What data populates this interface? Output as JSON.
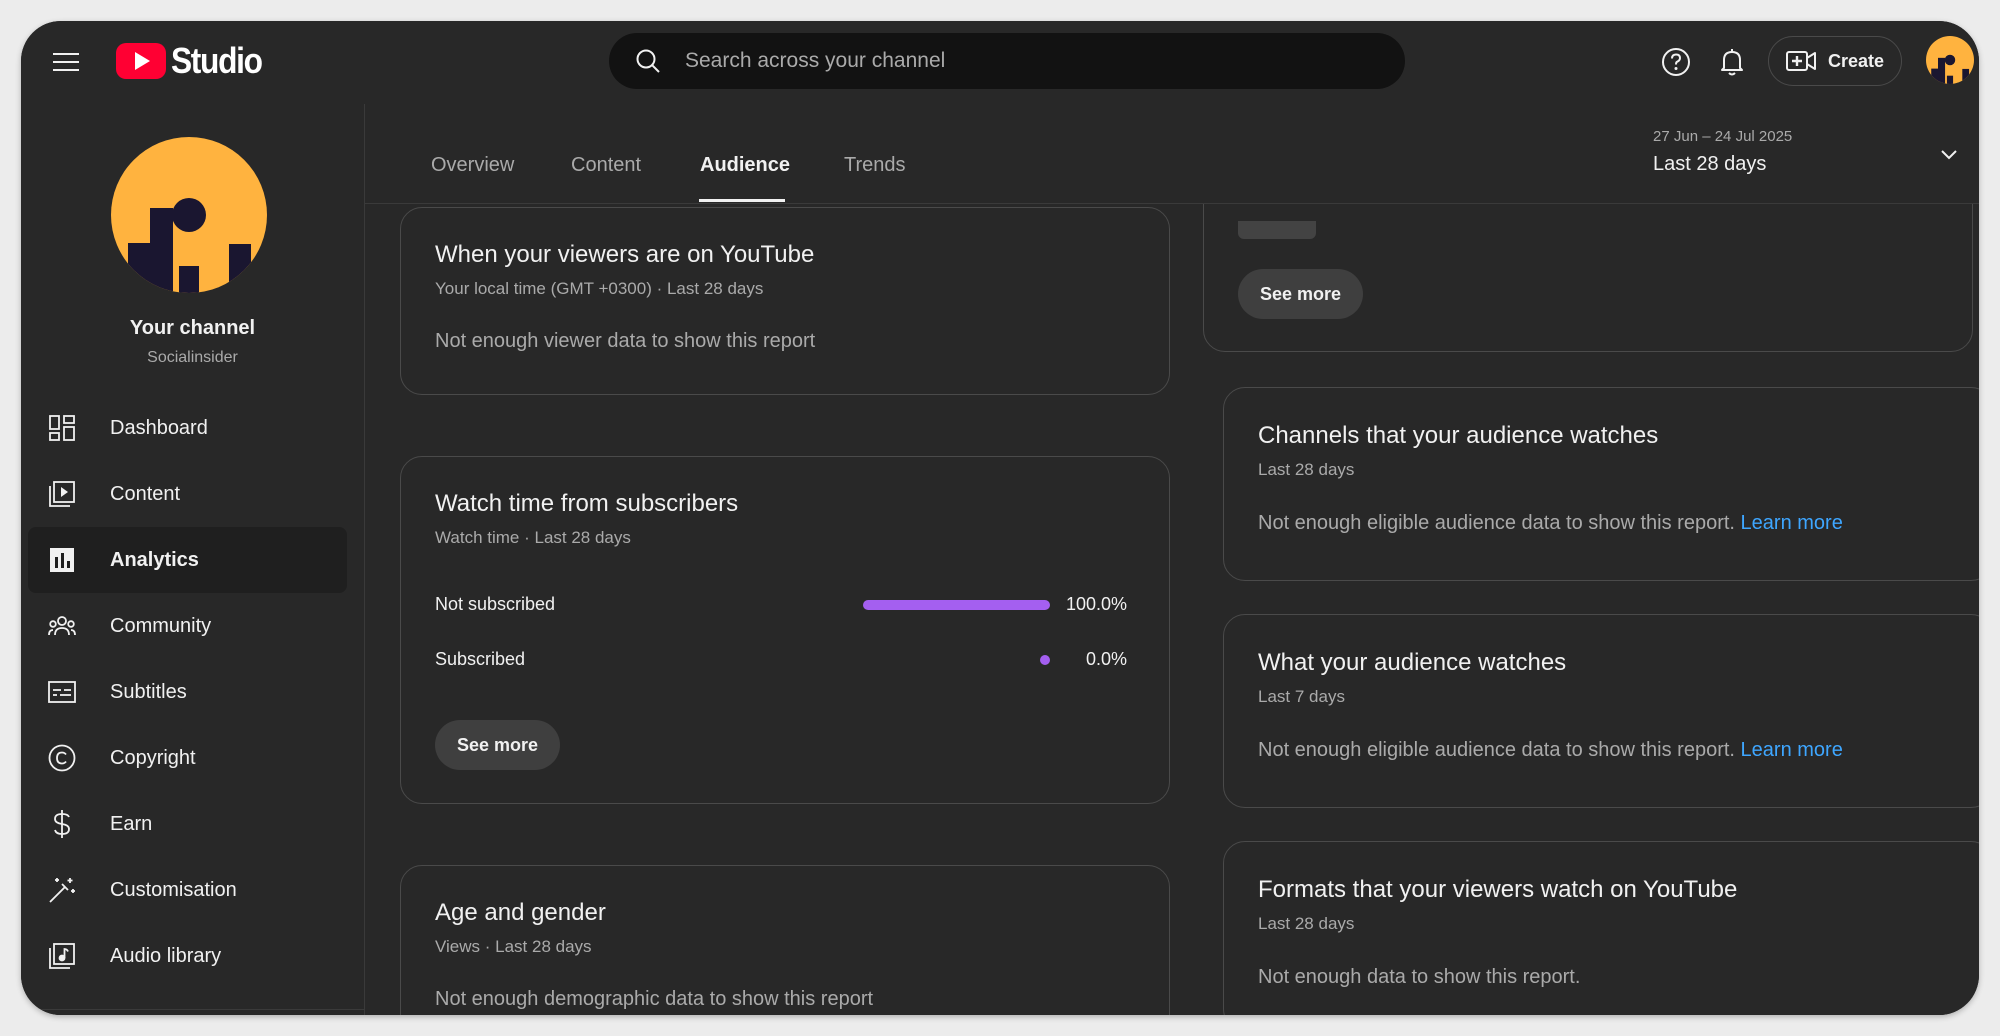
{
  "app": {
    "logo_text": "Studio"
  },
  "search": {
    "placeholder": "Search across your channel"
  },
  "header": {
    "create_label": "Create"
  },
  "channel": {
    "name": "Your channel",
    "handle": "Socialinsider"
  },
  "sidebar": {
    "items": [
      {
        "label": "Dashboard",
        "icon": "dashboard-icon"
      },
      {
        "label": "Content",
        "icon": "content-icon"
      },
      {
        "label": "Analytics",
        "icon": "analytics-icon",
        "active": true
      },
      {
        "label": "Community",
        "icon": "community-icon"
      },
      {
        "label": "Subtitles",
        "icon": "subtitles-icon"
      },
      {
        "label": "Copyright",
        "icon": "copyright-icon"
      },
      {
        "label": "Earn",
        "icon": "earn-icon"
      },
      {
        "label": "Customisation",
        "icon": "customisation-icon"
      },
      {
        "label": "Audio library",
        "icon": "audio-library-icon"
      }
    ]
  },
  "tabs": [
    {
      "label": "Overview"
    },
    {
      "label": "Content"
    },
    {
      "label": "Audience",
      "active": true
    },
    {
      "label": "Trends"
    }
  ],
  "date_range": {
    "range": "27 Jun – 24 Jul 2025",
    "label": "Last 28 days"
  },
  "cards": {
    "viewers_time": {
      "title": "When your viewers are on YouTube",
      "subtitle": "Your local time (GMT +0300) · Last 28 days",
      "message": "Not enough viewer data to show this report"
    },
    "watch_time_subs": {
      "title": "Watch time from subscribers",
      "subtitle": "Watch time · Last 28 days",
      "rows": [
        {
          "label": "Not subscribed",
          "value": "100.0%",
          "fraction": 1.0
        },
        {
          "label": "Subscribed",
          "value": "0.0%",
          "fraction": 0.0
        }
      ],
      "see_more": "See more"
    },
    "age_gender": {
      "title": "Age and gender",
      "subtitle": "Views · Last 28 days",
      "message": "Not enough demographic data to show this report"
    },
    "top_right": {
      "see_more": "See more"
    },
    "channels_watched": {
      "title": "Channels that your audience watches",
      "subtitle": "Last 28 days",
      "message": "Not enough eligible audience data to show this report.",
      "link": "Learn more"
    },
    "audience_watches": {
      "title": "What your audience watches",
      "subtitle": "Last 7 days",
      "message": "Not enough eligible audience data to show this report.",
      "link": "Learn more"
    },
    "formats": {
      "title": "Formats that your viewers watch on YouTube",
      "subtitle": "Last 28 days",
      "message": "Not enough data to show this report."
    }
  },
  "colors": {
    "accent_bar": "#a45ff0",
    "link": "#3ea6ff",
    "logo_red": "#ff0033",
    "avatar_yellow": "#ffb33f"
  }
}
